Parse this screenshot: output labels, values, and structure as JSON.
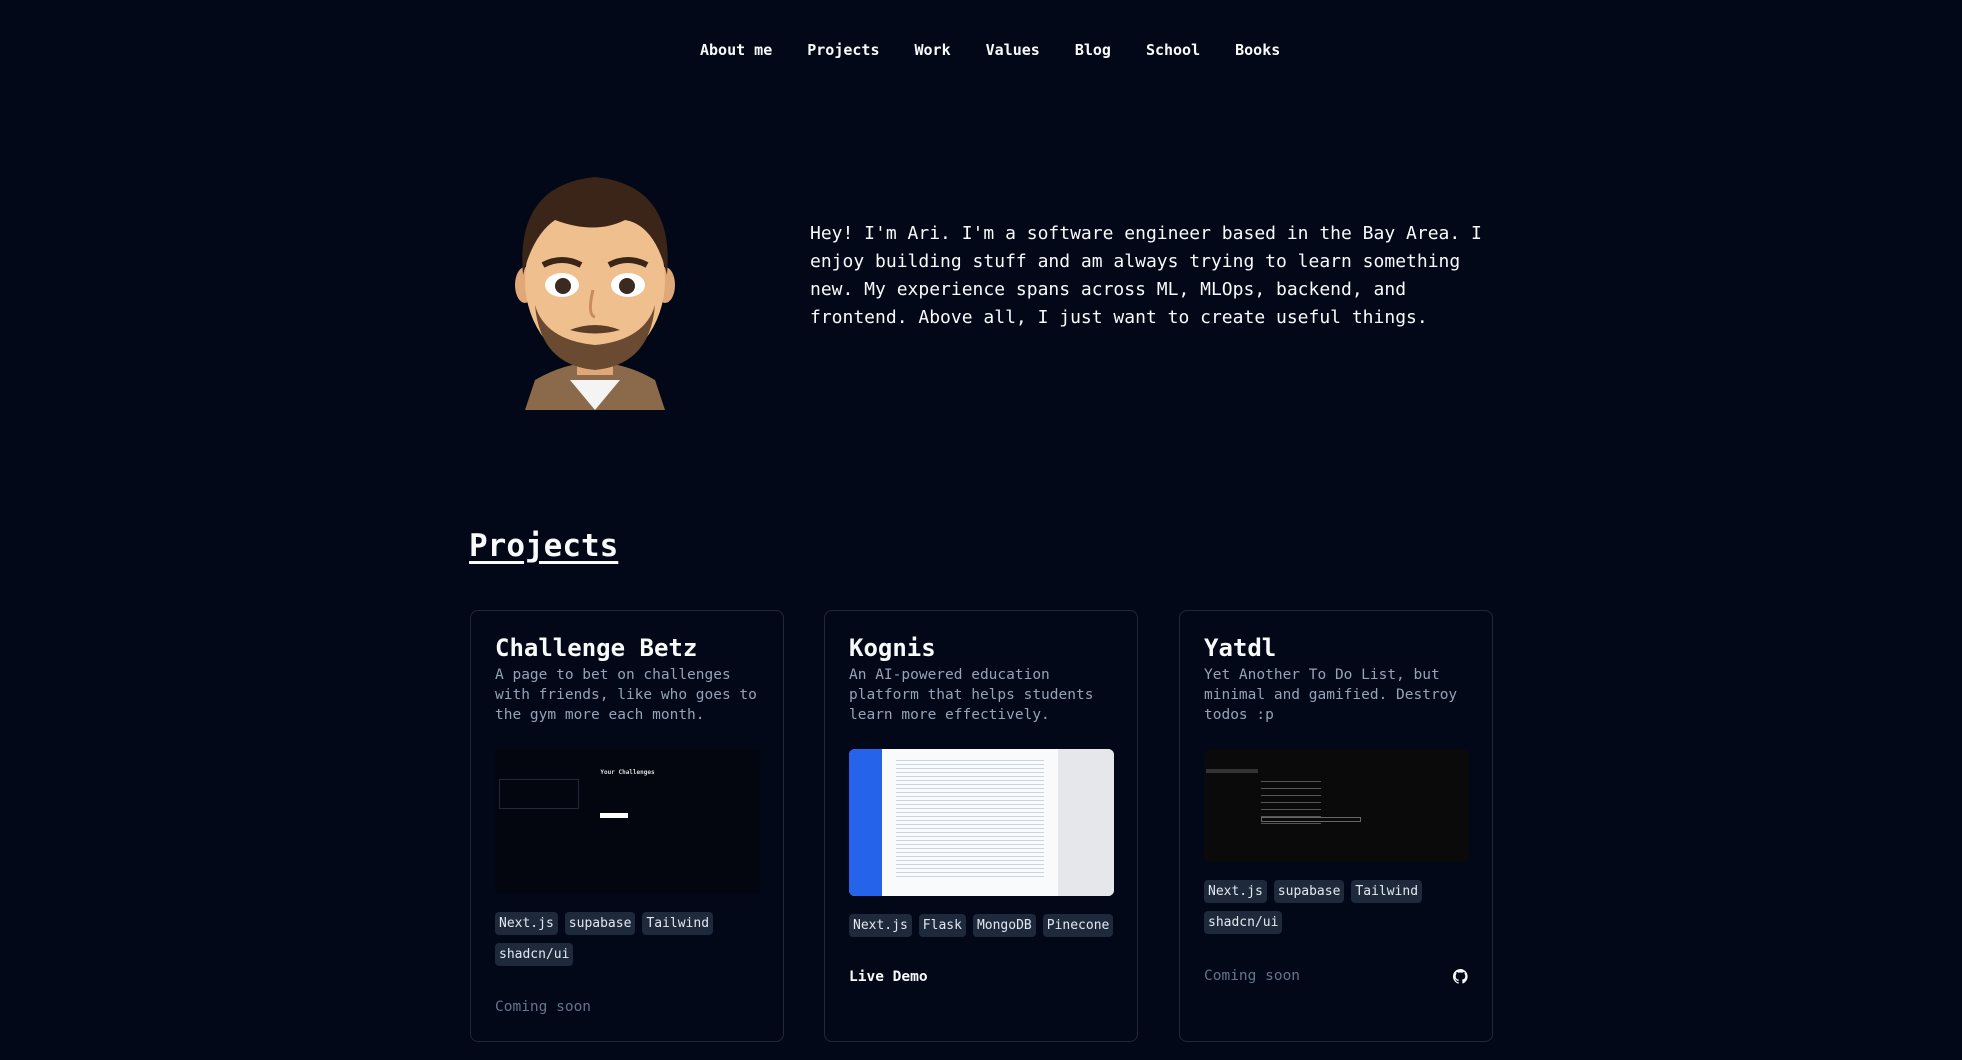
{
  "nav": [
    "About me",
    "Projects",
    "Work",
    "Values",
    "Blog",
    "School",
    "Books"
  ],
  "bio": "Hey! I'm Ari. I'm a software engineer based in the Bay Area. I enjoy building stuff and am always trying to learn something new. My experience spans across ML, MLOps, backend, and frontend. Above all, I just want to create useful things.",
  "projects_heading": "Projects",
  "projects": [
    {
      "title": "Challenge Betz",
      "desc": "A page to bet on challenges with friends, like who goes to the gym more each month.",
      "tags": [
        "Next.js",
        "supabase",
        "Tailwind",
        "shadcn/ui"
      ],
      "status": "Coming soon",
      "shot_title": "Your Challenges"
    },
    {
      "title": "Kognis",
      "desc": "An AI-powered education platform that helps students learn more effectively.",
      "tags": [
        "Next.js",
        "Flask",
        "MongoDB",
        "Pinecone"
      ],
      "link": "Live Demo"
    },
    {
      "title": "Yatdl",
      "desc": "Yet Another To Do List, but minimal and gamified. Destroy todos :p",
      "tags": [
        "Next.js",
        "supabase",
        "Tailwind",
        "shadcn/ui"
      ],
      "status": "Coming soon",
      "icon": "github-icon"
    }
  ],
  "colors": {
    "background": "#020817",
    "border": "#1e293b",
    "tag": "#1e293b",
    "kognis_sidebar": "#2563eb"
  }
}
